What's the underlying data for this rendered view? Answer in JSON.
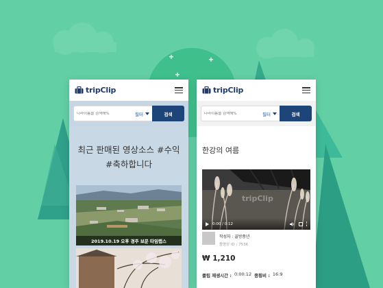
{
  "colors": {
    "background": "#63cfa5",
    "brand_navy": "#1e3a6e",
    "search_button": "#1e4579",
    "filter_text": "#1e5aa6"
  },
  "left_screen": {
    "logo": "tripClip",
    "search": {
      "placeholder": "나라이름을 검색해%",
      "filter_label": "필터",
      "button_label": "검색"
    },
    "headline_line1": "최근 판매된 영상소스 #수익",
    "headline_line2": "#축하합니다",
    "thumbnails": [
      {
        "caption": "2019.10.19 오후 경주 보문 타임랩스"
      },
      {
        "caption": ""
      }
    ]
  },
  "right_screen": {
    "logo": "tripClip",
    "search": {
      "placeholder": "나라이름을 검색해%",
      "filter_label": "필터",
      "button_label": "검색"
    },
    "title": "한강의 여름",
    "video": {
      "time": "0:00 / 0:12",
      "watermark": "tripClip"
    },
    "author": {
      "name": "작성자 : 골방중년",
      "video_id": "동영상 ID : 7536"
    },
    "price": "₩ 1,210",
    "meta": {
      "duration_label": "클립 재생시간 :",
      "duration_value": "0:00:12",
      "ratio_label": "종횡비 :",
      "ratio_value": "16:9"
    }
  }
}
